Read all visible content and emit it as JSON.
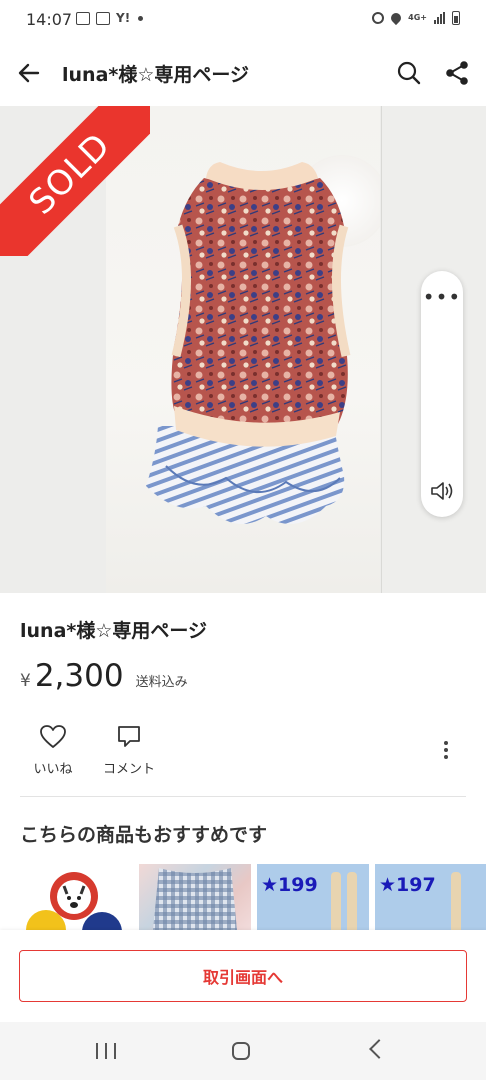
{
  "status_bar": {
    "time": "14:07",
    "yahoo_label": "Y!",
    "network_label": "4G+"
  },
  "header": {
    "title": "luna*様☆専用ページ"
  },
  "image": {
    "sold_label": "SOLD",
    "more_label": "•••"
  },
  "product": {
    "title": "luna*様☆専用ページ",
    "price_currency": "¥",
    "price": "2,300",
    "shipping_note": "送料込み"
  },
  "actions": {
    "like_label": "いいね",
    "comment_label": "コメント"
  },
  "recommendations": {
    "title": "こちらの商品もおすすめです",
    "items": [
      {
        "label": ""
      },
      {
        "label": ""
      },
      {
        "label": "★199"
      },
      {
        "label": "★197"
      }
    ]
  },
  "cta": {
    "label": "取引画面へ"
  },
  "colors": {
    "accent": "#e53935",
    "sold_banner": "#ea352d"
  }
}
